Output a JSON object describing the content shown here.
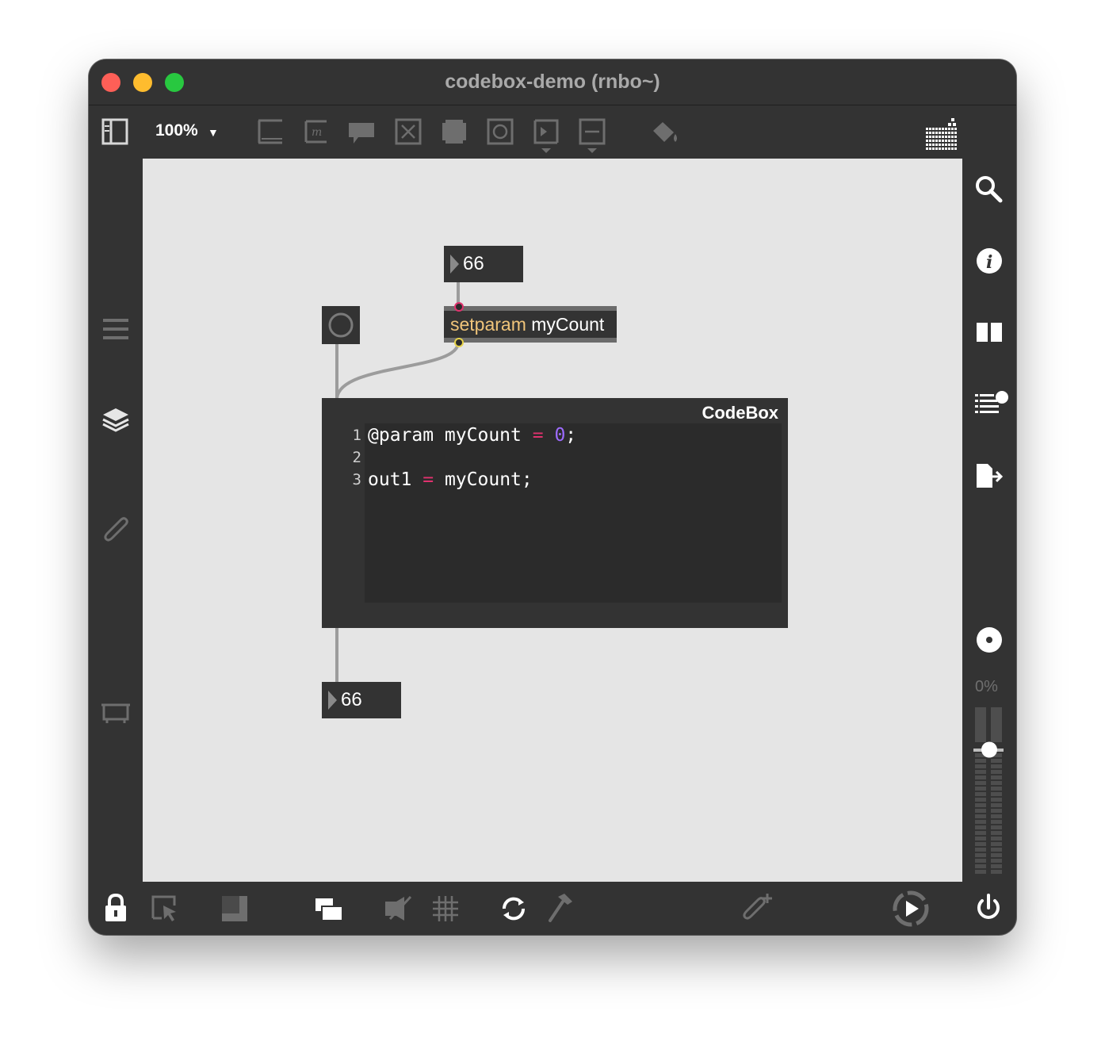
{
  "window": {
    "title": "codebox-demo (rnbo~)"
  },
  "toolbar": {
    "zoom_label": "100%",
    "icons": [
      "sidebar-toggle-icon",
      "object-box-icon",
      "message-box-icon",
      "comment-icon",
      "button-icon",
      "toggle-icon",
      "number-icon",
      "slider-icon",
      "flonum-icon",
      "paint-bucket-icon",
      "grid-icon"
    ]
  },
  "patch": {
    "top_number": "66",
    "setparam_keyword": "setparam",
    "setparam_arg": "myCount",
    "bottom_number": "66",
    "codebox": {
      "title": "CodeBox",
      "lines": [
        {
          "n": "1",
          "parts": [
            [
              "plain",
              "@param myCount "
            ],
            [
              "op",
              "="
            ],
            [
              "plain",
              " "
            ],
            [
              "num",
              "0"
            ],
            [
              "plain",
              ";"
            ]
          ]
        },
        {
          "n": "2",
          "parts": []
        },
        {
          "n": "3",
          "parts": [
            [
              "plain",
              "out1 "
            ],
            [
              "op",
              "="
            ],
            [
              "plain",
              " myCount;"
            ]
          ]
        }
      ]
    }
  },
  "right_sidebar": {
    "cpu_label": "0%",
    "volume_fraction": 0.75
  },
  "colors": {
    "window_bg": "#333333",
    "canvas_bg": "#e5e5e5",
    "setparam_keyword": "#f0c47a",
    "code_operator": "#e0326e",
    "code_number": "#9d6bff",
    "close": "#fe5f57",
    "minimize": "#febc2e",
    "zoom": "#28c840"
  }
}
